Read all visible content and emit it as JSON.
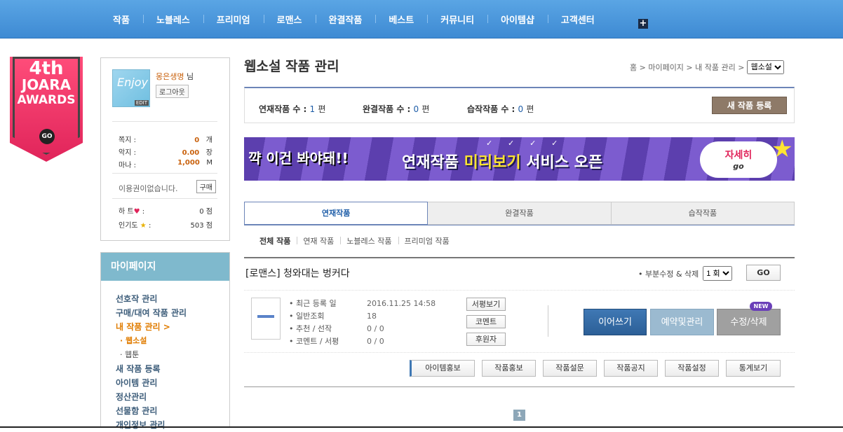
{
  "topnav": {
    "items": [
      "작품",
      "노블레스",
      "프리미엄",
      "로맨스",
      "완결작품",
      "베스트",
      "커뮤니티",
      "아이템샵",
      "고객센터"
    ],
    "plus": "+"
  },
  "award": {
    "line1": "4th",
    "line2": "JOARA",
    "line3": "AWARDS",
    "go": "GO"
  },
  "profile": {
    "avatar_sig": "Enjoy",
    "avatar_edit": "EDIT",
    "name": "몽은생명",
    "name_suffix": "님",
    "logout": "로그아웃",
    "rows": [
      {
        "label": "쪽지 :",
        "value": "0",
        "unit": "개"
      },
      {
        "label": "악지 :",
        "value": "0.00",
        "unit": "장"
      },
      {
        "label": "마나 :",
        "value": "1,000",
        "unit": "M"
      }
    ],
    "pass_text": "이용권이없습니다.",
    "buy": "구매",
    "heart_label": "하  트",
    "heart_value": "0 점",
    "pop_label": "인기도",
    "pop_value": "503 점"
  },
  "menu": {
    "head": "마이페이지",
    "items": [
      {
        "label": "선호작 관리"
      },
      {
        "label": "구매/대여 작품 관리"
      },
      {
        "label": "내 작품 관리  >"
      },
      {
        "label": "· 웹소설"
      },
      {
        "label": "· 웹툰"
      },
      {
        "label": "새 작품 등록"
      },
      {
        "label": "아이템 관리"
      },
      {
        "label": "정산관리"
      },
      {
        "label": "선물함 관리"
      },
      {
        "label": "개인정보 관리"
      }
    ]
  },
  "page": {
    "title": "웹소설 작품 관리",
    "crumbs": "홈 > 마이페이지 > 내 작품 관리 >",
    "select_value": "웹소설"
  },
  "stats": {
    "serial_label": "연재작품 수 :",
    "serial_count": "1",
    "complete_label": "완결작품 수 :",
    "complete_count": "0",
    "draft_label": "습작작품 수 :",
    "draft_count": "0",
    "unit": "편",
    "new_button": "새 작품 등록"
  },
  "banner": {
    "left": "꺅 이건 봐야돼!!",
    "checks": "✓ ✓ ✓ ✓",
    "main_a": "연재작품 ",
    "main_hl": "미리보기",
    "main_b": " 서비스 오픈",
    "go_top": "자세히",
    "go_bottom": "go"
  },
  "tabs": [
    "연재작품",
    "완결작품",
    "습작작품"
  ],
  "subtabs": [
    "전체 작품",
    "연재 작품",
    "노블레스 작품",
    "프리미엄 작품"
  ],
  "work": {
    "title": "[로맨스] 청와대는 벙커다",
    "partial_label": "• 부분수정 & 삭제",
    "episode_select": "1 회",
    "go": "GO",
    "info": [
      {
        "k": "• 최근 등록 일",
        "v": "2016.11.25 14:58"
      },
      {
        "k": "• 일반조회",
        "v": "18"
      },
      {
        "k": "• 추천 / 선작",
        "v": "0 / 0"
      },
      {
        "k": "• 코멘트 / 서평",
        "v": "0 / 0"
      }
    ],
    "small_buttons": [
      "서평보기",
      "코멘트",
      "후원자"
    ],
    "continue": "이어쓰기",
    "reserve": "예약및관리",
    "edit": "수정/삭제",
    "new_badge": "NEW",
    "actions": [
      "아이템홍보",
      "작품홍보",
      "작품설문",
      "작품공지",
      "작품설정",
      "통계보기"
    ]
  },
  "pagination": {
    "current": "1"
  }
}
